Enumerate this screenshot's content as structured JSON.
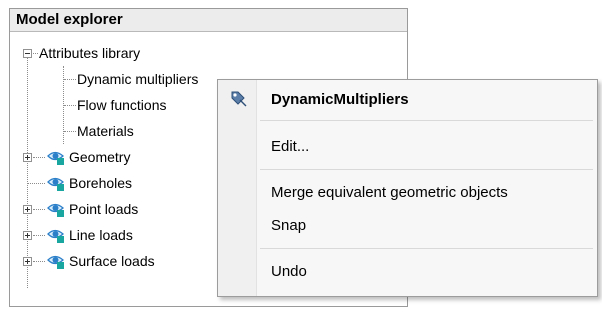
{
  "panel": {
    "title": "Model explorer"
  },
  "tree": {
    "library": {
      "label": "Attributes library",
      "expanded": true
    },
    "library_children": [
      {
        "label": "Dynamic multipliers"
      },
      {
        "label": "Flow functions"
      },
      {
        "label": "Materials"
      }
    ],
    "items": [
      {
        "label": "Geometry",
        "expandable": true,
        "icon": "eye-icon"
      },
      {
        "label": "Boreholes",
        "expandable": false,
        "icon": "eye-icon"
      },
      {
        "label": "Point loads",
        "expandable": true,
        "icon": "eye-icon"
      },
      {
        "label": "Line loads",
        "expandable": true,
        "icon": "eye-icon"
      },
      {
        "label": "Surface loads",
        "expandable": true,
        "icon": "eye-icon"
      }
    ]
  },
  "context_menu": {
    "title": "DynamicMultipliers",
    "title_icon": "multiplier-icon",
    "items": [
      {
        "label": "Edit..."
      },
      {
        "label": "Merge equivalent geometric objects"
      },
      {
        "label": "Snap"
      },
      {
        "label": "Undo"
      }
    ]
  },
  "colors": {
    "eye_blue": "#2b7fc9",
    "eye_teal": "#1aa6a0",
    "panel_header": "#ececec",
    "menu_bg": "#f7f7f7"
  }
}
